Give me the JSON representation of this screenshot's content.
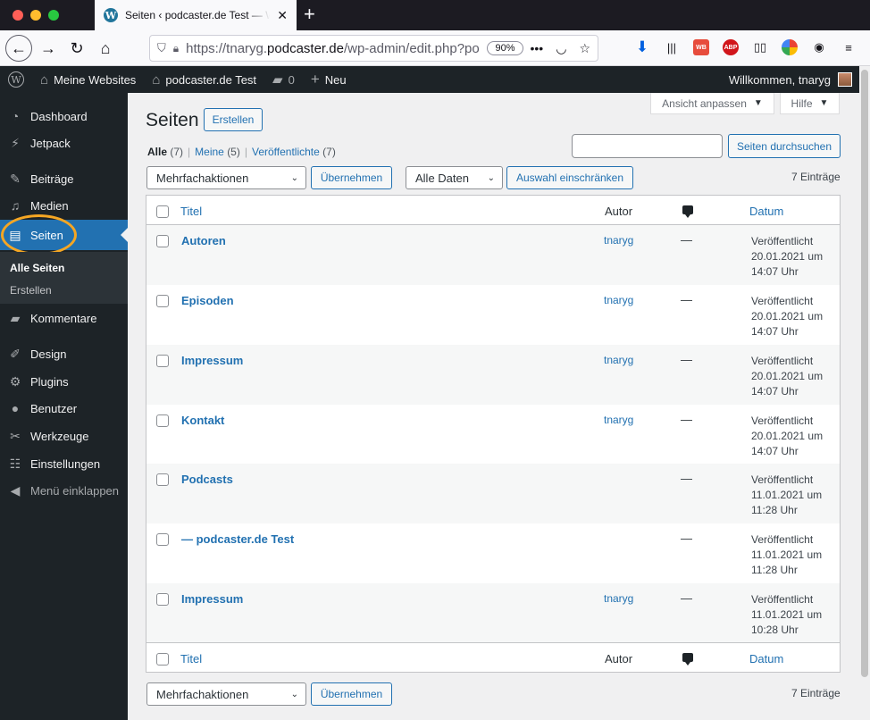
{
  "browser": {
    "tab_title": "Seiten ‹ podcaster.de Test — WordPress",
    "tab_favicon": "W",
    "url_prefix": "https://tnaryg.",
    "url_host": "podcaster.de",
    "url_path": "/wp-admin/edit.php?post_type=page",
    "zoom": "90%",
    "newtab_symbol": "+"
  },
  "adminbar": {
    "wp_logo": "W",
    "my_sites": "Meine Websites",
    "site_name": "podcaster.de Test",
    "comments_count": "0",
    "new_label": "Neu",
    "greeting": "Willkommen, tnaryg"
  },
  "sidebar": {
    "items": [
      {
        "label": "Dashboard",
        "icon": "dashboard-icon",
        "glyph": "◔"
      },
      {
        "label": "Jetpack",
        "icon": "jetpack-icon",
        "glyph": "⚡"
      },
      {
        "label": "Beiträge",
        "icon": "pin-icon",
        "glyph": "✎"
      },
      {
        "label": "Medien",
        "icon": "media-icon",
        "glyph": "♫"
      },
      {
        "label": "Seiten",
        "icon": "pages-icon",
        "glyph": "▤"
      },
      {
        "label": "Kommentare",
        "icon": "comments-icon",
        "glyph": "▰"
      },
      {
        "label": "Design",
        "icon": "brush-icon",
        "glyph": "✐"
      },
      {
        "label": "Plugins",
        "icon": "plugins-icon",
        "glyph": "⚙"
      },
      {
        "label": "Benutzer",
        "icon": "users-icon",
        "glyph": "●"
      },
      {
        "label": "Werkzeuge",
        "icon": "tools-icon",
        "glyph": "✂"
      },
      {
        "label": "Einstellungen",
        "icon": "settings-icon",
        "glyph": "☷"
      },
      {
        "label": "Menü einklappen",
        "icon": "collapse-icon",
        "glyph": "◀"
      }
    ],
    "submenu": {
      "all_pages": "Alle Seiten",
      "create": "Erstellen"
    }
  },
  "header": {
    "title": "Seiten",
    "add_new": "Erstellen",
    "screen_options": "Ansicht anpassen",
    "help": "Hilfe"
  },
  "views": {
    "all": "Alle",
    "all_count": "(7)",
    "mine": "Meine",
    "mine_count": "(5)",
    "published": "Veröffentlichte",
    "published_count": "(7)"
  },
  "search": {
    "value": "",
    "button": "Seiten durchsuchen"
  },
  "filters": {
    "bulk_action": "Mehrfachaktionen",
    "apply": "Übernehmen",
    "dates": "Alle Daten",
    "filter": "Auswahl einschränken",
    "item_count": "7 Einträge"
  },
  "table": {
    "columns": {
      "title": "Titel",
      "author": "Autor",
      "date": "Datum"
    },
    "rows": [
      {
        "title": "Autoren",
        "author": "tnaryg",
        "comments": "—",
        "status": "Veröffentlicht",
        "date": "20.01.2021 um",
        "time": "14:07 Uhr"
      },
      {
        "title": "Episoden",
        "author": "tnaryg",
        "comments": "—",
        "status": "Veröffentlicht",
        "date": "20.01.2021 um",
        "time": "14:07 Uhr"
      },
      {
        "title": "Impressum",
        "author": "tnaryg",
        "comments": "—",
        "status": "Veröffentlicht",
        "date": "20.01.2021 um",
        "time": "14:07 Uhr"
      },
      {
        "title": "Kontakt",
        "author": "tnaryg",
        "comments": "—",
        "status": "Veröffentlicht",
        "date": "20.01.2021 um",
        "time": "14:07 Uhr"
      },
      {
        "title": "Podcasts",
        "author": "",
        "comments": "—",
        "status": "Veröffentlicht",
        "date": "11.01.2021 um",
        "time": "11:28 Uhr"
      },
      {
        "title": "— podcaster.de Test",
        "author": "",
        "comments": "—",
        "status": "Veröffentlicht",
        "date": "11.01.2021 um",
        "time": "11:28 Uhr"
      },
      {
        "title": "Impressum",
        "author": "tnaryg",
        "comments": "—",
        "status": "Veröffentlicht",
        "date": "11.01.2021 um",
        "time": "10:28 Uhr"
      }
    ]
  },
  "colors": {
    "accent": "#2271b1",
    "admin_dark": "#1d2327",
    "highlight_ring": "#f5a623"
  }
}
